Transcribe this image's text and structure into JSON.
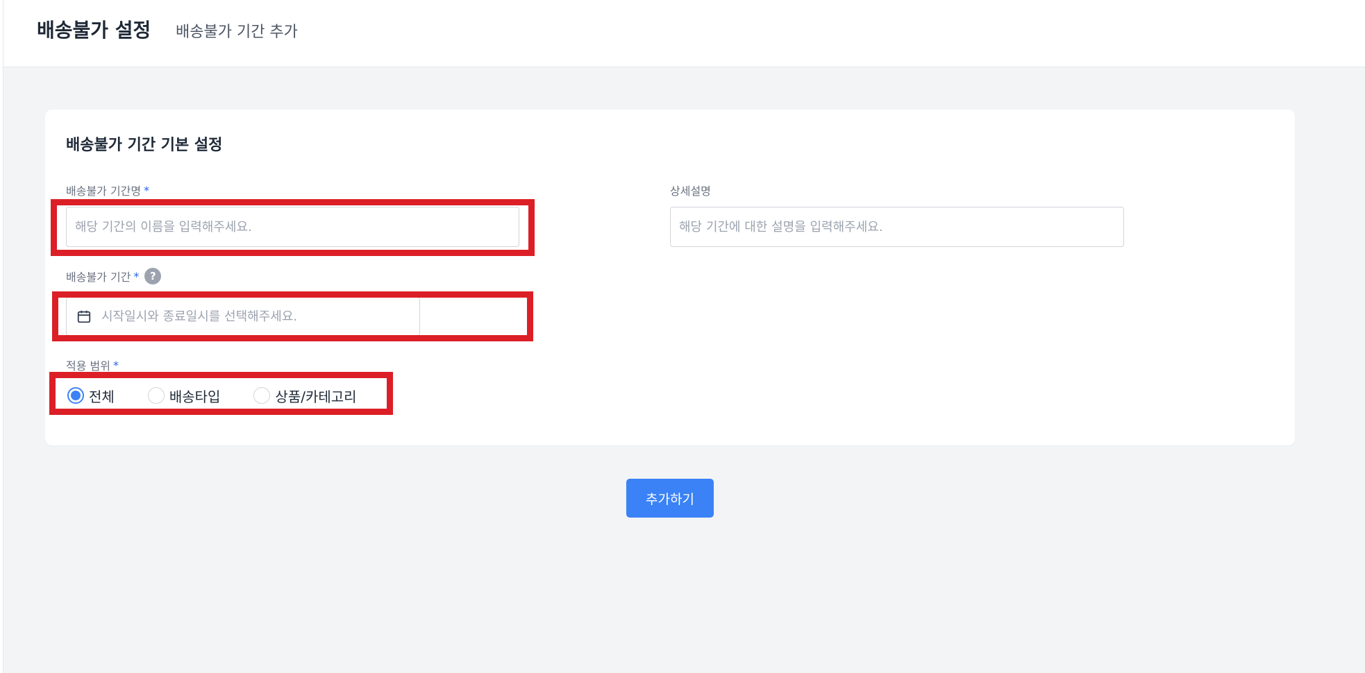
{
  "header": {
    "title": "배송불가 설정",
    "subtitle": "배송불가 기간 추가"
  },
  "form": {
    "section_title": "배송불가 기간 기본 설정",
    "name": {
      "label": "배송불가 기간명",
      "required_mark": "*",
      "value": "",
      "placeholder": "해당 기간의 이름을 입력해주세요."
    },
    "description": {
      "label": "상세설명",
      "value": "",
      "placeholder": "해당 기간에 대한 설명을 입력해주세요."
    },
    "period": {
      "label": "배송불가 기간",
      "required_mark": "*",
      "help_icon_glyph": "?",
      "value": "",
      "placeholder": "시작일시와 종료일시를 선택해주세요."
    },
    "scope": {
      "label": "적용 범위",
      "required_mark": "*",
      "options": [
        {
          "label": "전체",
          "checked": true
        },
        {
          "label": "배송타입",
          "checked": false
        },
        {
          "label": "상품/카테고리",
          "checked": false
        }
      ]
    }
  },
  "actions": {
    "add_label": "추가하기"
  },
  "icons": {
    "calendar": "calendar-icon",
    "help": "question-circle-icon"
  },
  "colors": {
    "primary": "#3b82f6",
    "highlight": "#dc1f26",
    "background": "#f3f4f6"
  }
}
